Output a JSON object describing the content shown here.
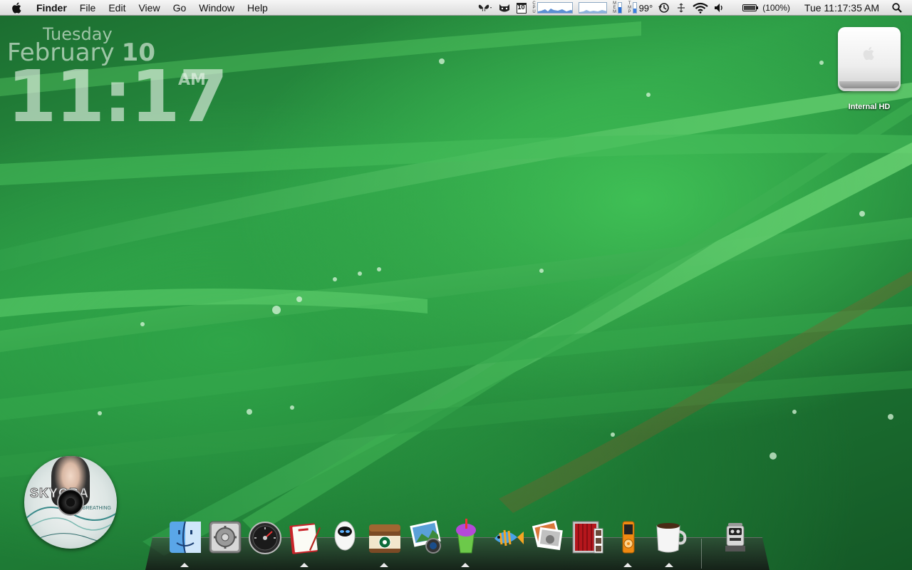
{
  "menubar": {
    "app_name": "Finder",
    "menus": [
      "File",
      "Edit",
      "View",
      "Go",
      "Window",
      "Help"
    ],
    "calendar_day": "10",
    "cpu_label": "CPU",
    "mem_label": "MEM",
    "temp_label": "TMP",
    "temperature": "99°",
    "mem_level": 0.55,
    "temp_level": 0.45,
    "battery_text": "(100%)",
    "battery_level": 1.0,
    "clock": "Tue 11:17:35 AM",
    "icons": [
      "apple-icon",
      "butterfly-icon",
      "cat-icon",
      "calendar-icon",
      "cpu-graph",
      "network-graph",
      "memory-meter",
      "temperature-meter",
      "time-machine-icon",
      "bluetooth-icon",
      "wifi-icon",
      "volume-icon",
      "battery-icon",
      "spotlight-icon"
    ]
  },
  "clock_widget": {
    "day": "Tuesday",
    "month": "February",
    "date": "10",
    "time": "11:17",
    "ampm": "AM"
  },
  "desktop": {
    "drive_label": "Internal HD"
  },
  "cd_widget": {
    "art_text": "SKYORA",
    "subtitle": "OF BREATHING"
  },
  "dock": {
    "items": [
      {
        "name": "finder-icon",
        "running": true
      },
      {
        "name": "system-preferences-icon",
        "running": false
      },
      {
        "name": "itunes-dashboard-icon",
        "running": false
      },
      {
        "name": "notebook-icon",
        "running": true
      },
      {
        "name": "eve-robot-icon",
        "running": false
      },
      {
        "name": "starbucks-app-icon",
        "running": true
      },
      {
        "name": "iphoto-icon",
        "running": false
      },
      {
        "name": "slushie-icon",
        "running": true
      },
      {
        "name": "fish-icon",
        "running": false
      },
      {
        "name": "photo-stack-icon",
        "running": false
      },
      {
        "name": "photo-booth-icon",
        "running": false
      },
      {
        "name": "ipod-icon",
        "running": true
      },
      {
        "name": "coffee-cup-icon",
        "running": true
      },
      {
        "name": "trash-robot-icon",
        "running": false
      }
    ]
  },
  "colors": {
    "wallpaper": "#2b9a45",
    "menubar": "#e8e8e8",
    "accent": "#2b6fd6"
  }
}
